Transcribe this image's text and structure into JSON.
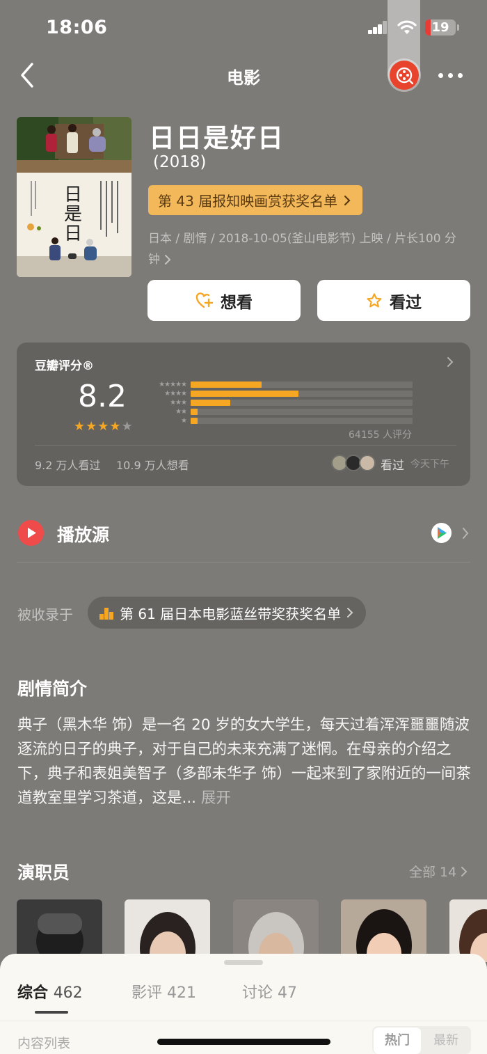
{
  "status_bar": {
    "time": "18:06",
    "battery": "19"
  },
  "nav": {
    "title": "电影"
  },
  "movie": {
    "title": "日日是好日",
    "year": "(2018)",
    "award_tag": "第 43 届报知映画赏获奖名单",
    "meta_line1": "日本 / 剧情 / 2018-10-05(釜山电影节) 上映 / 片长100 分",
    "meta_line2": "钟",
    "want_label": "想看",
    "watched_label": "看过"
  },
  "rating": {
    "label": "豆瓣评分®",
    "score": "8.2",
    "stars": 4,
    "count": "64155 人评分",
    "distribution": [
      {
        "stars": 5,
        "fraction": 0.32
      },
      {
        "stars": 4,
        "fraction": 0.485
      },
      {
        "stars": 3,
        "fraction": 0.18
      },
      {
        "stars": 2,
        "fraction": 0.03
      },
      {
        "stars": 1,
        "fraction": 0.03
      }
    ],
    "watched_stat": "9.2 万人看过",
    "want_stat": "10.9 万人想看",
    "friend_action": "看过",
    "friend_time": "今天下午"
  },
  "play": {
    "label": "播放源"
  },
  "collections": {
    "label": "被收录于",
    "chip": "第 61 届日本电影蓝丝带奖获奖名单"
  },
  "synopsis": {
    "heading": "剧情简介",
    "text": "典子（黑木华 饰）是一名 20 岁的女大学生，每天过着浑浑噩噩随波逐流的日子的典子，对于自己的未来充满了迷惘。在母亲的介绍之下，典子和表姐美智子（多部未华子 饰）一起来到了家附近的一间茶道教室里学习茶道，这是...",
    "expand": "展开"
  },
  "cast": {
    "heading": "演职员",
    "all_label": "全部 14"
  },
  "sheet": {
    "tabs": [
      {
        "label": "综合",
        "count": "462"
      },
      {
        "label": "影评",
        "count": "421"
      },
      {
        "label": "讨论",
        "count": "47"
      }
    ],
    "list_label": "内容列表",
    "sort_hot": "热门",
    "sort_new": "最新"
  },
  "colors": {
    "accent": "#f5a623",
    "award_bg": "#f3b85a",
    "play_red": "#f04b4b",
    "background": "#7d7b77"
  },
  "icons": [
    "back-icon",
    "more-icon",
    "app-icon",
    "heart-plus-icon",
    "star-icon",
    "play-icon",
    "chevron-right-icon",
    "collection-icon"
  ]
}
